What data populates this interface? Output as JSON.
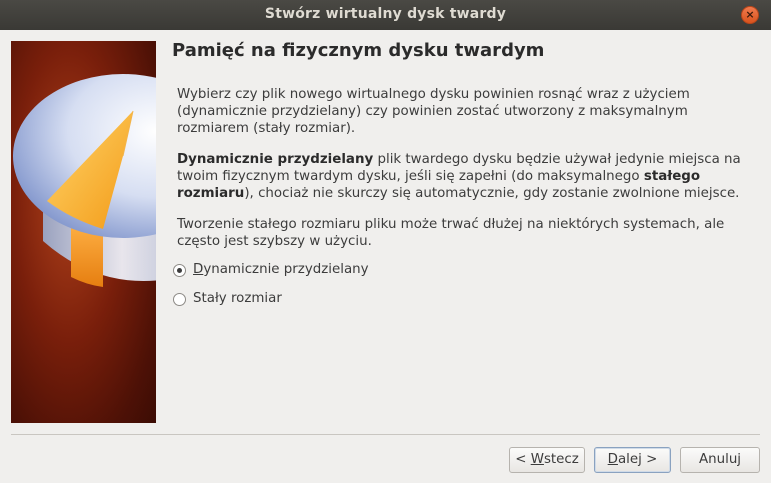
{
  "window": {
    "title": "Stwórz wirtualny dysk twardy",
    "close_glyph": "×"
  },
  "page": {
    "heading": "Pamięć na fizycznym dysku twardym",
    "paragraph1": "Wybierz czy plik nowego wirtualnego dysku powinien rosnąć wraz z użyciem (dynamicznie przydzielany) czy powinien zostać utworzony z maksymalnym rozmiarem (stały rozmiar).",
    "paragraph2": {
      "bold1": "Dynamicznie przydzielany",
      "text1": " plik twardego dysku będzie używał jedynie miejsca na twoim fizycznym twardym dysku, jeśli się zapełni (do maksymalnego ",
      "bold2": "stałego rozmiaru",
      "text2": "), chociaż nie skurczy się automatycznie, gdy zostanie zwolnione miejsce."
    },
    "paragraph3": "Tworzenie stałego rozmiaru pliku może trwać dłużej na niektórych systemach, ale często jest szybszy w użyciu.",
    "options": [
      {
        "label_mnemonic": "D",
        "label_rest": "ynamicznie przydzielany",
        "checked": true
      },
      {
        "label_mnemonic": "",
        "label_rest": "Stały rozmiar",
        "checked": false
      }
    ]
  },
  "buttons": {
    "back": {
      "prefix": "< ",
      "mnemonic": "W",
      "rest": "stecz"
    },
    "next": {
      "mnemonic": "D",
      "rest": "alej >"
    },
    "cancel": {
      "label": "Anuluj"
    }
  },
  "colors": {
    "titlebar": "#3c3b37",
    "close": "#e95420",
    "art_background": "#7a1f0b",
    "window_bg": "#f0efed"
  },
  "icons": {
    "side_art": "hard-disk-icon",
    "close": "close-icon"
  }
}
